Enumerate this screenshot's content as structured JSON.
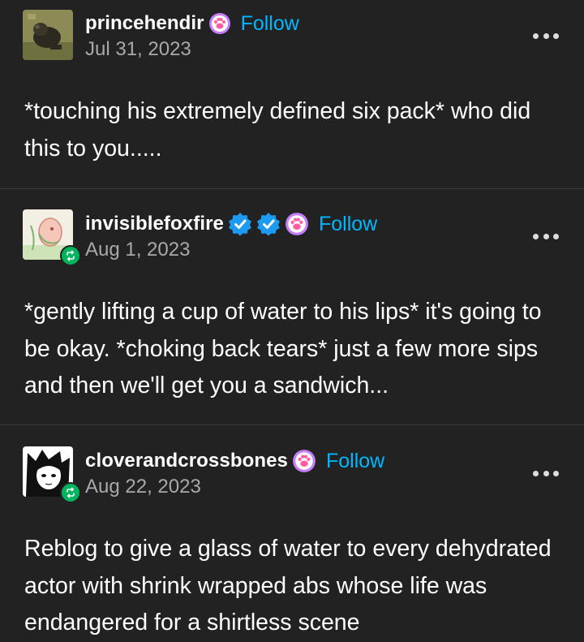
{
  "colors": {
    "background": "#222222",
    "follow_link": "#00b8ff",
    "verified": "#1d9bf0",
    "reblog_badge": "#00b35c",
    "date_text": "#a9a9a9"
  },
  "posts": [
    {
      "username": "princehendir",
      "badges": [
        "paw-badge-icon"
      ],
      "follow_label": "Follow",
      "date": "Jul 31, 2023",
      "reblogged": false,
      "body": "*touching his extremely defined six pack* who did this to you....."
    },
    {
      "username": "invisiblefoxfire",
      "badges": [
        "verified-badge-icon",
        "verified-badge-icon",
        "paw-badge-icon"
      ],
      "follow_label": "Follow",
      "date": "Aug 1, 2023",
      "reblogged": true,
      "body": "*gently lifting a cup of water to his lips* it's going to be okay. *choking back tears* just a few more sips and then we'll get you a sandwich..."
    },
    {
      "username": "cloverandcrossbones",
      "badges": [
        "paw-badge-icon"
      ],
      "follow_label": "Follow",
      "date": "Aug 22, 2023",
      "reblogged": true,
      "body": "Reblog to give a glass of water to every dehydrated actor with shrink wrapped abs whose life was endangered for a shirtless scene"
    }
  ]
}
